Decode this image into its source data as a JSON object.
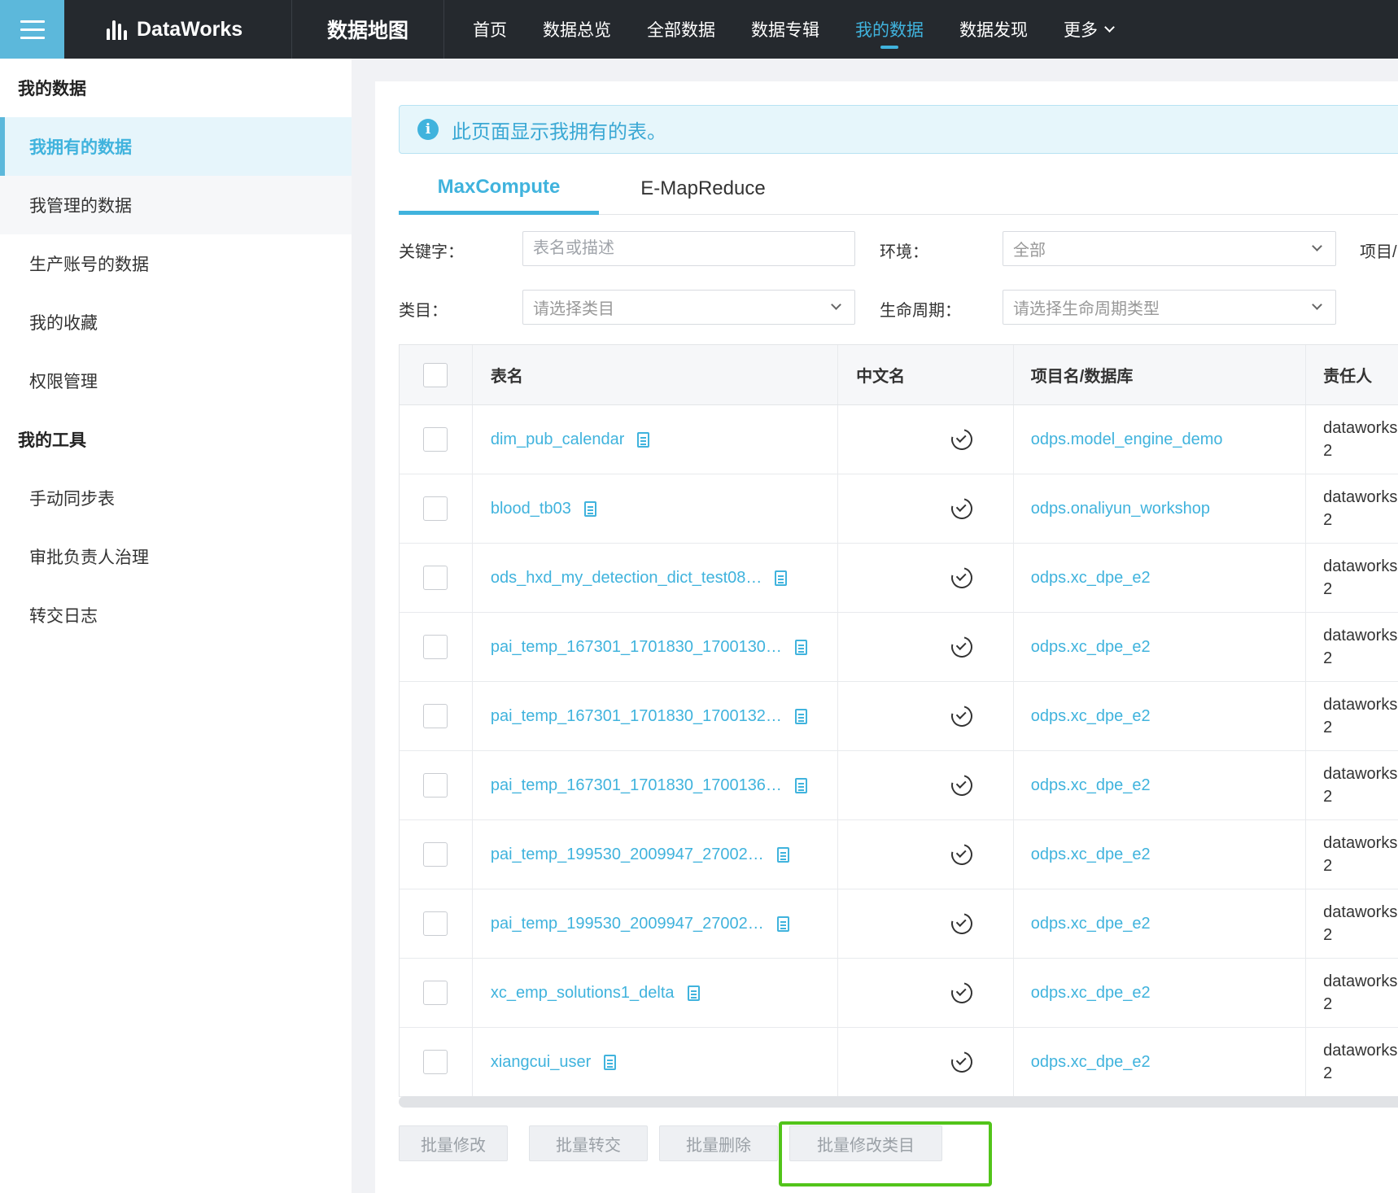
{
  "header": {
    "brand": "DataWorks",
    "section": "数据地图",
    "nav": [
      "首页",
      "数据总览",
      "全部数据",
      "数据专辑",
      "我的数据",
      "数据发现",
      "更多"
    ],
    "active_nav": "我的数据"
  },
  "sidebar": {
    "group1": "我的数据",
    "items1": [
      "我拥有的数据",
      "我管理的数据",
      "生产账号的数据",
      "我的收藏",
      "权限管理"
    ],
    "group2": "我的工具",
    "items2": [
      "手动同步表",
      "审批负责人治理",
      "转交日志"
    ]
  },
  "main": {
    "alert": "此页面显示我拥有的表。",
    "tabs": [
      "MaxCompute",
      "E-MapReduce"
    ],
    "filters": {
      "keyword_label": "关键字：",
      "keyword_placeholder": "表名或描述",
      "env_label": "环境：",
      "env_value": "全部",
      "project_label": "项目/",
      "category_label": "类目：",
      "category_placeholder": "请选择类目",
      "lifecycle_label": "生命周期：",
      "lifecycle_placeholder": "请选择生命周期类型"
    },
    "table": {
      "headers": [
        "表名",
        "中文名",
        "项目名/数据库",
        "责任人"
      ],
      "rows": [
        {
          "name": "dim_pub_calendar",
          "project": "odps.model_engine_demo",
          "owner1": "dataworks",
          "owner2": "2"
        },
        {
          "name": "blood_tb03",
          "project": "odps.onaliyun_workshop",
          "owner1": "dataworks",
          "owner2": "2"
        },
        {
          "name": "ods_hxd_my_detection_dict_test08…",
          "project": "odps.xc_dpe_e2",
          "owner1": "dataworks",
          "owner2": "2"
        },
        {
          "name": "pai_temp_167301_1701830_1700130…",
          "project": "odps.xc_dpe_e2",
          "owner1": "dataworks",
          "owner2": "2"
        },
        {
          "name": "pai_temp_167301_1701830_1700132…",
          "project": "odps.xc_dpe_e2",
          "owner1": "dataworks",
          "owner2": "2"
        },
        {
          "name": "pai_temp_167301_1701830_1700136…",
          "project": "odps.xc_dpe_e2",
          "owner1": "dataworks",
          "owner2": "2"
        },
        {
          "name": "pai_temp_199530_2009947_27002…",
          "project": "odps.xc_dpe_e2",
          "owner1": "dataworks",
          "owner2": "2"
        },
        {
          "name": "pai_temp_199530_2009947_27002…",
          "project": "odps.xc_dpe_e2",
          "owner1": "dataworks",
          "owner2": "2"
        },
        {
          "name": "xc_emp_solutions1_delta",
          "project": "odps.xc_dpe_e2",
          "owner1": "dataworks",
          "owner2": "2"
        },
        {
          "name": "xiangcui_user",
          "project": "odps.xc_dpe_e2",
          "owner1": "dataworks",
          "owner2": "2"
        }
      ]
    },
    "batch_buttons": [
      "批量修改",
      "批量转交",
      "批量删除",
      "批量修改类目"
    ]
  },
  "colors": {
    "accent": "#40b3dd",
    "topbar": "#25292e",
    "highlight": "#52c41a"
  }
}
